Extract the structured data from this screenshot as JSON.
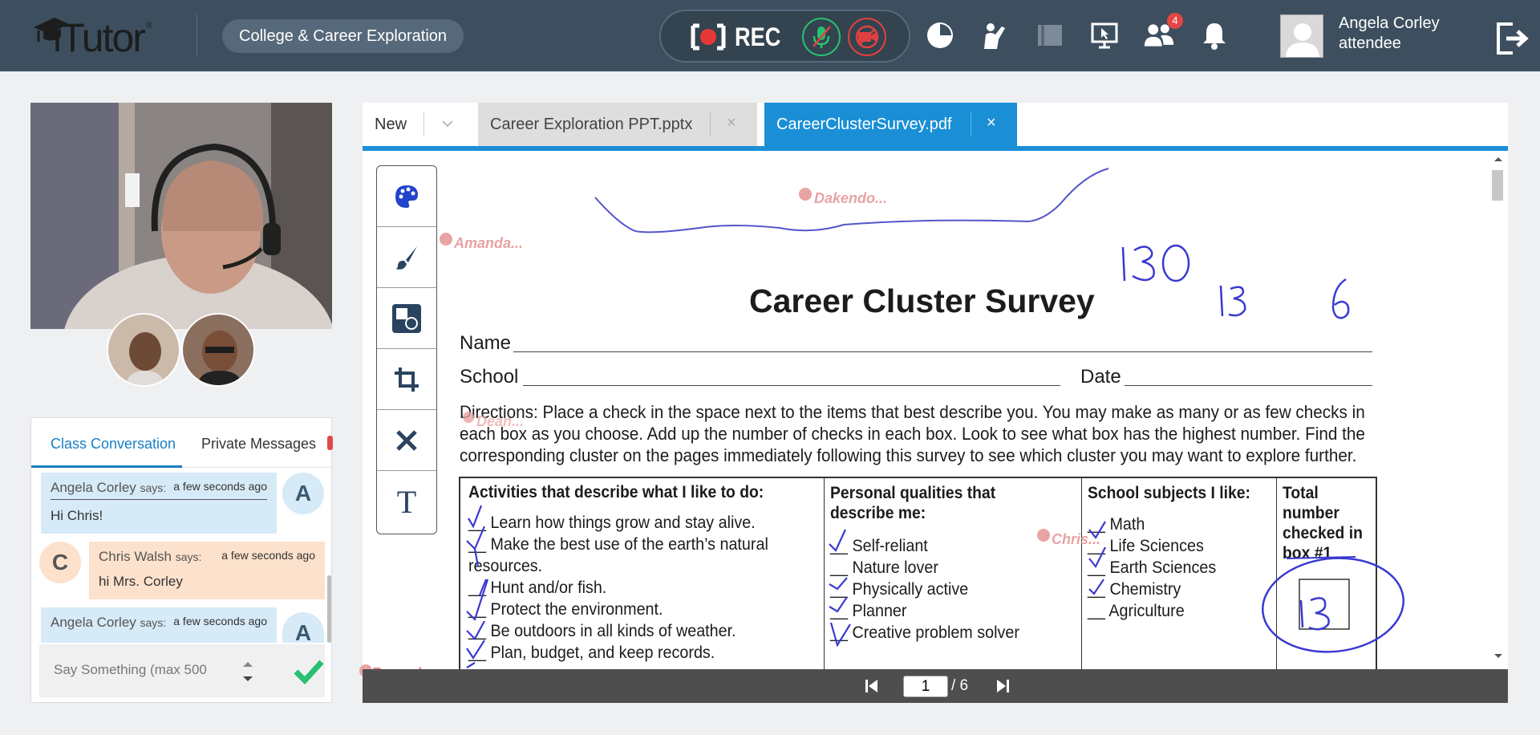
{
  "app": {
    "logo_text": "iTutor",
    "logo_mark": "®",
    "class_name": "College & Career Exploration",
    "rec_label": "REC",
    "notifications_badge": "4",
    "user": {
      "name": "Angela Corley",
      "role": "attendee"
    },
    "icons": [
      "record-icon",
      "mic-muted-icon",
      "camera-off-icon",
      "pie-chart-icon",
      "raise-hand-icon",
      "whiteboard-icon",
      "screen-share-icon",
      "participants-icon",
      "bell-icon",
      "logout-icon"
    ]
  },
  "chat": {
    "tabs": [
      {
        "label": "Class Conversation"
      },
      {
        "label": "Private Messages"
      }
    ],
    "messages": [
      {
        "author": "Angela Corley",
        "verb": "says:",
        "time": "a few seconds ago",
        "text": "Hi Chris!",
        "initial": "A"
      },
      {
        "author": "Chris Walsh",
        "verb": "says:",
        "time": "a few seconds ago",
        "text": "hi Mrs. Corley",
        "initial": "C"
      },
      {
        "author": "Angela Corley",
        "verb": "says:",
        "time": "a few seconds ago",
        "text": "",
        "initial": "A"
      }
    ],
    "input_placeholder": "Say Something (max 500"
  },
  "tabs": {
    "new_label": "New",
    "doc_tabs": [
      {
        "label": "Career Exploration PPT.pptx",
        "active": false
      },
      {
        "label": "CareerClusterSurvey.pdf",
        "active": true
      }
    ],
    "close_glyph": "×"
  },
  "tools": [
    "palette-icon",
    "brush-icon",
    "shapes-icon",
    "crop-icon",
    "clear-icon",
    "text-icon"
  ],
  "tool_text_glyph": "T",
  "document": {
    "title": "Career Cluster Survey",
    "name_label": "Name",
    "school_label": "School",
    "date_label": "Date",
    "directions": [
      "Directions:  Place a check in the space next to the items that best describe you. You may make as many or as few checks in",
      "each box as you choose. Add up the number of checks in each box. Look to see what box has the highest number. Find the",
      "corresponding cluster on the pages immediately following this survey to see which cluster you may want to explore further."
    ],
    "columns": [
      {
        "heading": [
          "Activities that describe what I like to do:"
        ],
        "items": [
          "__ Learn how things grow and stay alive.",
          "__ Make the best use of the earth’s natural",
          "    resources.",
          "__ Hunt and/or fish.",
          "__ Protect the environment.",
          "__ Be outdoors in all kinds of weather.",
          "__ Plan, budget, and keep records."
        ]
      },
      {
        "heading": [
          "Personal qualities that",
          "describe me:"
        ],
        "items": [
          "__ Self-reliant",
          "__ Nature lover",
          "__ Physically active",
          "__ Planner",
          "__ Creative problem solver"
        ]
      },
      {
        "heading": [
          "School subjects I like:"
        ],
        "items": [
          "__ Math",
          "__ Life Sciences",
          "__ Earth Sciences",
          "__ Chemistry",
          "__ Agriculture"
        ]
      },
      {
        "heading": [
          "Total",
          "number",
          "checked in",
          "box #1"
        ],
        "items": []
      }
    ],
    "handwriting": {
      "n1": "130",
      "n2": "13",
      "n3": "6",
      "box_total": "13"
    },
    "cursors": [
      "Dakendo...",
      "Amanda...",
      "Dean...",
      "Chris...",
      "Recorder"
    ]
  },
  "pager": {
    "current": "1",
    "total": "/ 6"
  }
}
